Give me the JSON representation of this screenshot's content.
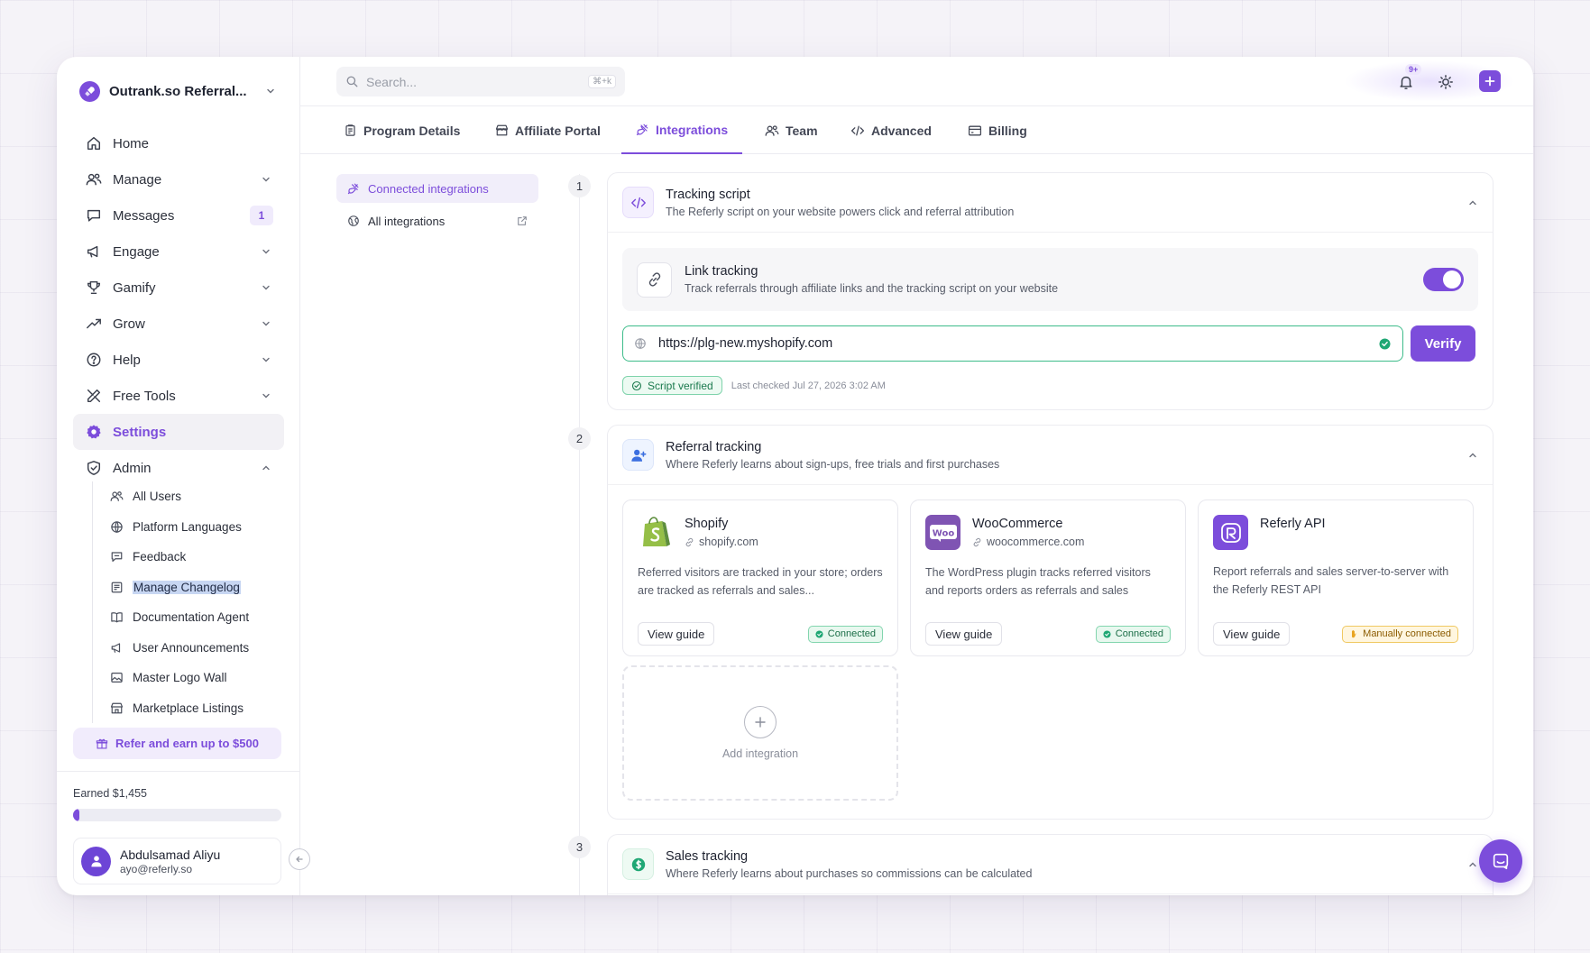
{
  "sidebar": {
    "org_name": "Outrank.so Referral...",
    "nav": [
      {
        "label": "Home",
        "icon": "home-icon"
      },
      {
        "label": "Manage",
        "icon": "users-icon"
      },
      {
        "label": "Messages",
        "icon": "message-icon",
        "badge": "1"
      },
      {
        "label": "Engage",
        "icon": "megaphone-icon"
      },
      {
        "label": "Gamify",
        "icon": "trophy-icon"
      },
      {
        "label": "Grow",
        "icon": "trend-up-icon"
      },
      {
        "label": "Help",
        "icon": "help-circle-icon"
      },
      {
        "label": "Free Tools",
        "icon": "tools-icon"
      },
      {
        "label": "Settings",
        "icon": "gear-icon",
        "active": true
      },
      {
        "label": "Admin",
        "icon": "shield-icon",
        "expanded": true
      }
    ],
    "admin_items": [
      {
        "label": "All Users",
        "icon": "users-icon"
      },
      {
        "label": "Platform Languages",
        "icon": "globe-icon"
      },
      {
        "label": "Feedback",
        "icon": "chat-icon"
      },
      {
        "label": "Manage Changelog",
        "icon": "newspaper-icon",
        "selected": true
      },
      {
        "label": "Documentation Agent",
        "icon": "book-icon"
      },
      {
        "label": "User Announcements",
        "icon": "megaphone-icon"
      },
      {
        "label": "Master Logo Wall",
        "icon": "image-icon"
      },
      {
        "label": "Marketplace Listings",
        "icon": "store-icon"
      }
    ],
    "refer_label": "Refer and earn up to $500",
    "earned_label": "Earned $1,455",
    "earned_progress": 0.03,
    "user": {
      "name": "Abdulsamad Aliyu",
      "email": "ayo@referly.so"
    }
  },
  "topbar": {
    "search_placeholder": "Search...",
    "search_shortcut": "⌘+k",
    "notification_count": "9+"
  },
  "tabs": [
    {
      "label": "Program Details",
      "icon": "clipboard-icon"
    },
    {
      "label": "Affiliate Portal",
      "icon": "store-icon"
    },
    {
      "label": "Integrations",
      "icon": "plug-icon",
      "active": true
    },
    {
      "label": "Team",
      "icon": "team-icon"
    },
    {
      "label": "Advanced",
      "icon": "code-icon"
    },
    {
      "label": "Billing",
      "icon": "card-icon"
    }
  ],
  "subnav": [
    {
      "label": "Connected integrations",
      "active": true
    },
    {
      "label": "All integrations",
      "external": true
    }
  ],
  "steps": [
    "1",
    "2",
    "3"
  ],
  "tracking_script": {
    "title": "Tracking script",
    "description": "The Referly script on your website powers click and referral attribution",
    "link_tracking": {
      "title": "Link tracking",
      "description": "Track referrals through affiliate links and the tracking script on your website",
      "enabled": true
    },
    "url_value": "https://plg-new.myshopify.com",
    "verify_label": "Verify",
    "verified_label": "Script verified",
    "last_checked": "Last checked Jul 27, 2026 3:02 AM"
  },
  "referral_tracking": {
    "title": "Referral tracking",
    "description": "Where Referly learns about sign-ups, free trials and first purchases",
    "integrations": [
      {
        "name": "Shopify",
        "domain": "shopify.com",
        "description": "Referred visitors are tracked in your store; orders are tracked as referrals and sales...",
        "guide_label": "View guide",
        "status": "Connected",
        "status_kind": "ok",
        "brand_color": "#95bf47"
      },
      {
        "name": "WooCommerce",
        "domain": "woocommerce.com",
        "description": "The WordPress plugin tracks referred visitors and reports orders as referrals and sales",
        "guide_label": "View guide",
        "status": "Connected",
        "status_kind": "ok",
        "brand_color": "#7f54b3"
      },
      {
        "name": "Referly API",
        "domain": "",
        "description": "Report referrals and sales server-to-server with the Referly REST API",
        "guide_label": "View guide",
        "status": "Manually connected",
        "status_kind": "warn",
        "brand_color": "#7c4ddb"
      }
    ],
    "add_label": "Add integration"
  },
  "sales_tracking": {
    "title": "Sales tracking",
    "description": "Where Referly learns about purchases so commissions can be calculated"
  },
  "colors": {
    "accent": "#7c4ddb",
    "success": "#3dbc8a",
    "warning": "#f0c962"
  }
}
